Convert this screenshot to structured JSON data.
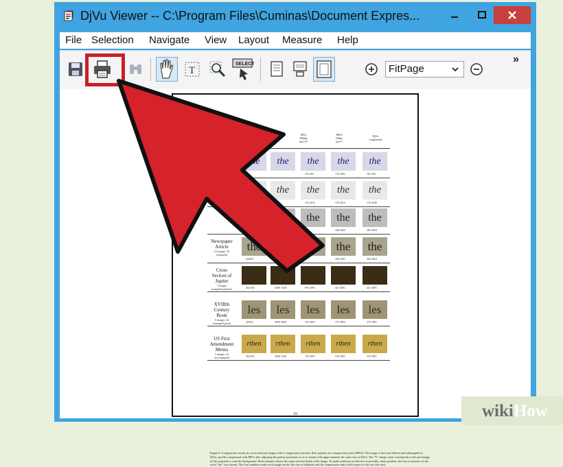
{
  "window": {
    "title": "DjVu Viewer -- C:\\Program Files\\Cuminas\\Document Expres...",
    "minimize": "–",
    "maximize": "□",
    "close": "✕"
  },
  "menu": [
    "File",
    "Selection",
    "Navigate",
    "View",
    "Layout",
    "Measure",
    "Help"
  ],
  "toolbar": {
    "zoom_value": "FitPage",
    "overflow": "»"
  },
  "document": {
    "headers": [
      "JPEG\n384dpi\nsize=27\nsample...",
      "JPEG\n96dpi\nsize=7\nsample...",
      "DjVu\ncompressed"
    ],
    "rows": [
      {
        "label": "",
        "sub": "",
        "glyph": "the",
        "caps": [
          "",
          "",
          "376 203",
          "176 3091",
          "185 304"
        ]
      },
      {
        "label": "",
        "sub": "",
        "glyph": "the",
        "caps": [
          "",
          "",
          "376 2015",
          "176 2015",
          "176 2045"
        ]
      },
      {
        "label": "",
        "sub": "",
        "glyph": "the",
        "caps": [
          "",
          "",
          "",
          "428 3000",
          "385 3004"
        ]
      },
      {
        "label": "Newspaper\nArticle",
        "sub": "24 images: 24\nresampled",
        "glyph": "the",
        "caps": [
          "(3000)",
          "",
          "",
          "420 3091",
          "426 3004"
        ]
      },
      {
        "label": "Cross\nSection of\nJupiter",
        "sub": "3 images\nresampled pipeline",
        "glyph": "",
        "caps": [
          "264 001",
          "2000 1540",
          "876 3091",
          "421 3091",
          "421 3091"
        ]
      },
      {
        "label": "XVIIIth\nCentury\nBook",
        "sub": "6 images: 43\nresampled pixels",
        "glyph": "les",
        "caps": [
          "(2030)",
          "3000 3000",
          "376 3091",
          "375 3004",
          "376 3091"
        ]
      },
      {
        "label": "US First\nAmendment\nMemo",
        "sub": "3 images: 33\nnot resampled",
        "glyph": "rthen",
        "caps": [
          "264 001",
          "2000 1540",
          "376 3091",
          "376 3091",
          "376 3091"
        ]
      }
    ],
    "caption": "Figure 6: Compression results for seven selected images with 5 compression formats. Raw number are compression ratios (JPEG). The image is fine size filtered and subsampled in DjVu, and the compressed with JPEG after adjusting the quality parameter so as to obtain a file approximately the same size as DjVu. The \"%\" image value corresponds to the percentage of bits required to code the background. Both schemes choose the same selected detail of the image. To make solutions as effective as possible, when possible, the first occurrence of the word \"the\" was chosen. The four numbers under each image are the file size in kilobytes and the compression ratio (with respect to the raw file size).",
    "page_number": "10"
  },
  "watermark": {
    "part1": "wiki",
    "part2": "How"
  },
  "colors": {
    "titlebar": "#3fa4e0",
    "close": "#c7413d",
    "arrow": "#d5222b",
    "highlight_box": "#c91f2b"
  }
}
